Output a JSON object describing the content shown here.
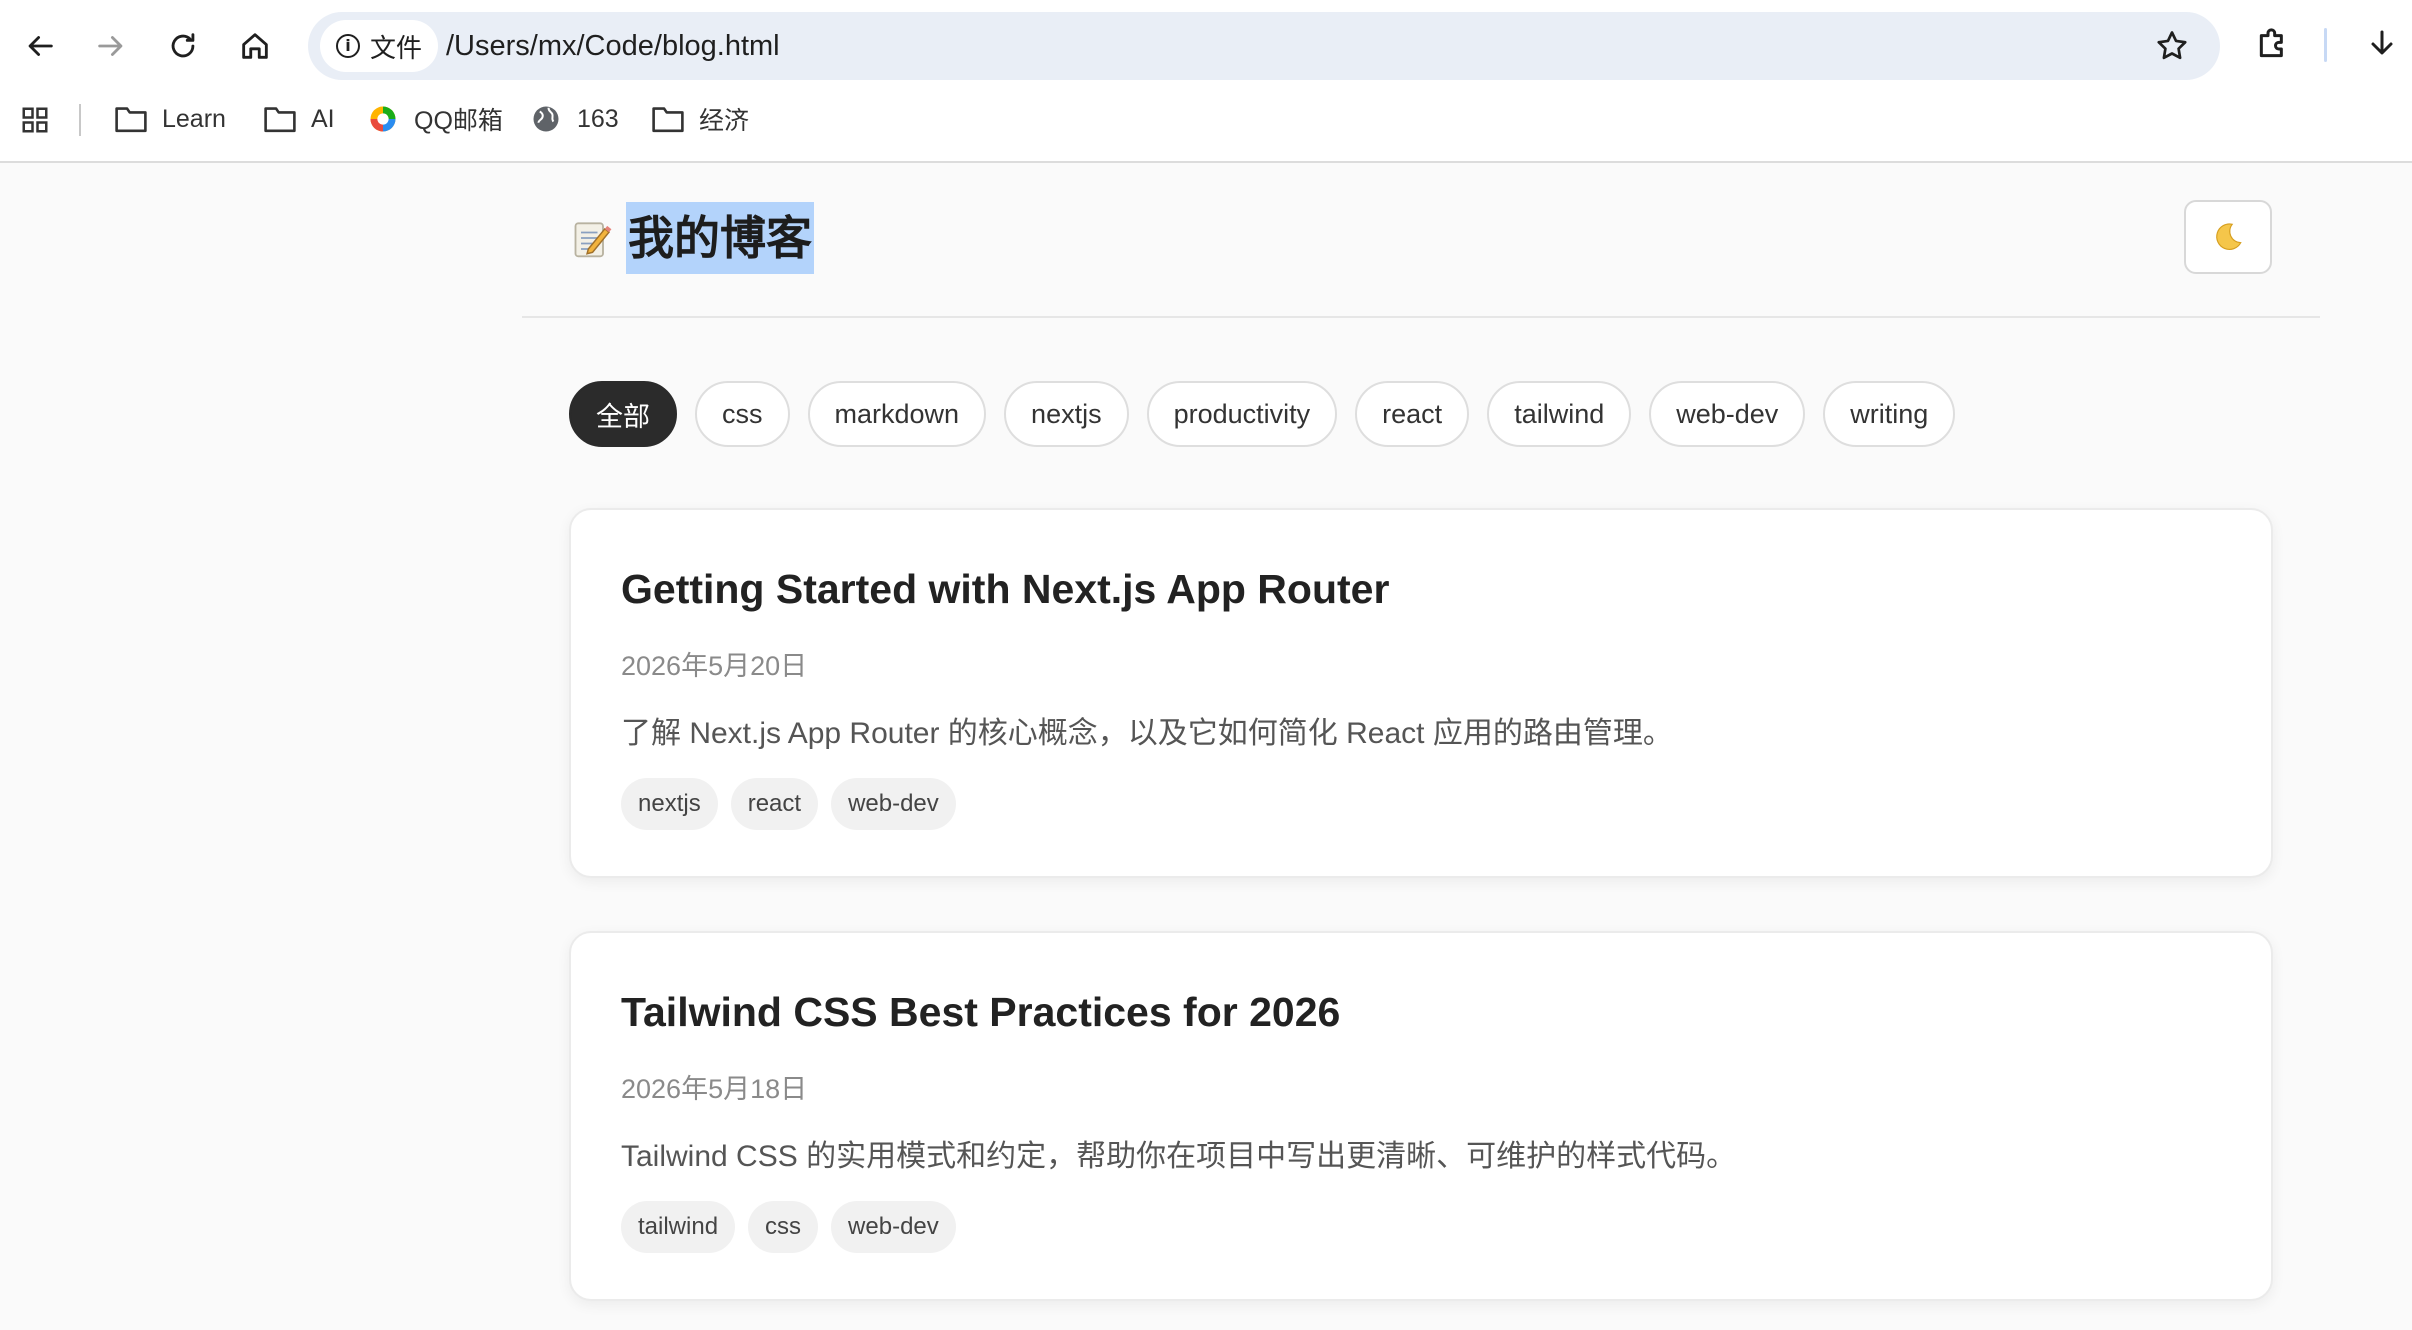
{
  "browser": {
    "site_chip_label": "文件",
    "url": "/Users/mx/Code/blog.html",
    "bookmarks": [
      {
        "label": "Learn",
        "icon": "folder-icon"
      },
      {
        "label": "AI",
        "icon": "folder-icon"
      },
      {
        "label": "QQ邮箱",
        "icon": "qqmail-icon"
      },
      {
        "label": "163",
        "icon": "globe-icon"
      },
      {
        "label": "经济",
        "icon": "folder-icon"
      }
    ]
  },
  "header": {
    "icon": "memo-icon",
    "title": "我的博客",
    "theme_toggle_icon": "moon-icon"
  },
  "filters": {
    "active": "全部",
    "tags": [
      "全部",
      "css",
      "markdown",
      "nextjs",
      "productivity",
      "react",
      "tailwind",
      "web-dev",
      "writing"
    ]
  },
  "posts": [
    {
      "title": "Getting Started with Next.js App Router",
      "date": "2026年5月20日",
      "description": "了解 Next.js App Router 的核心概念，以及它如何简化 React 应用的路由管理。",
      "tags": [
        "nextjs",
        "react",
        "web-dev"
      ]
    },
    {
      "title": "Tailwind CSS Best Practices for 2026",
      "date": "2026年5月18日",
      "description": "Tailwind CSS 的实用模式和约定，帮助你在项目中写出更清晰、可维护的样式代码。",
      "tags": [
        "tailwind",
        "css",
        "web-dev"
      ]
    }
  ],
  "colors": {
    "page_bg": "#fafafa",
    "active_tag_bg": "#2b2b2b",
    "selection": "#b3d3fb",
    "omnibox_bg": "#e9eef6"
  }
}
